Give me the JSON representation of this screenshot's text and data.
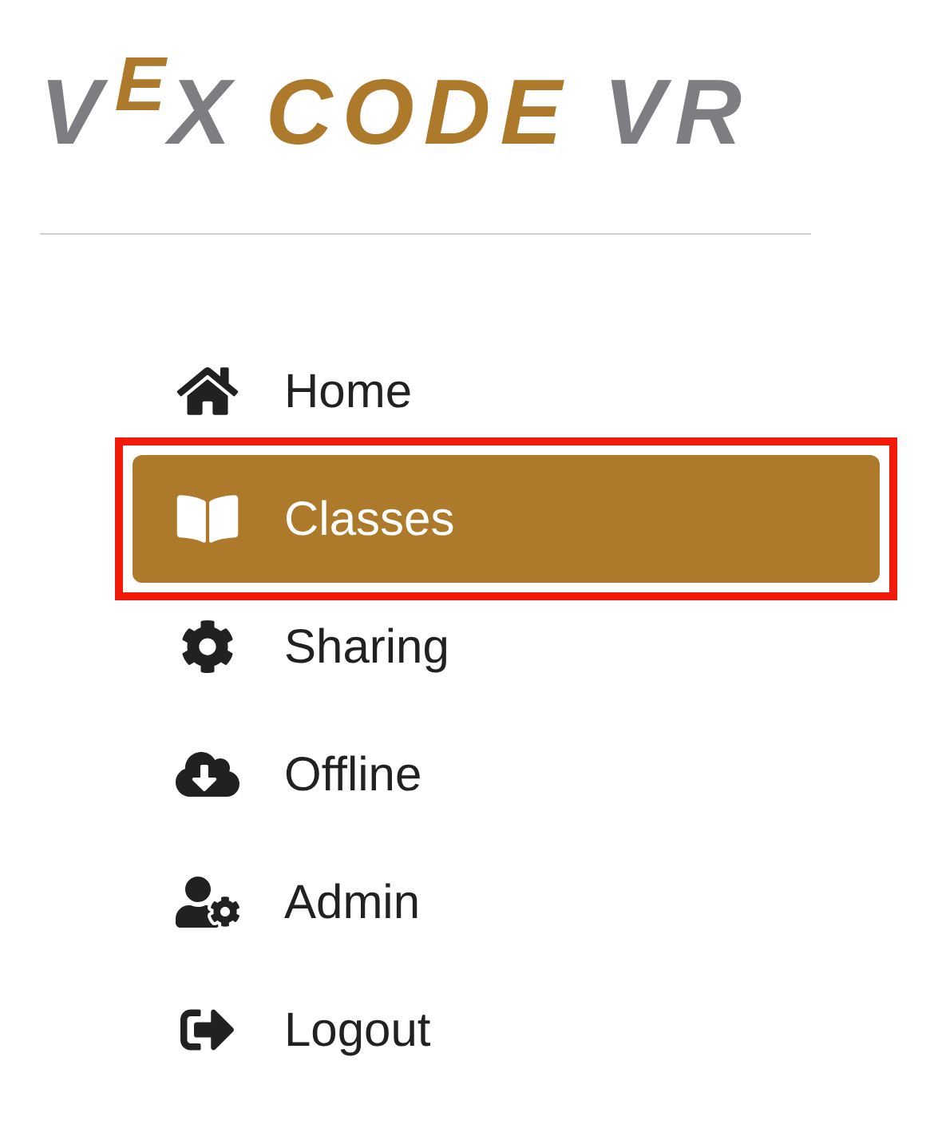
{
  "logo": {
    "brand_start": "V",
    "brand_mark": "E",
    "brand_end": "X",
    "product": "CODE",
    "suffix": "VR"
  },
  "menu": [
    {
      "label": "Home",
      "kind": "home",
      "selected": false,
      "highlighted": false
    },
    {
      "label": "Classes",
      "kind": "book",
      "selected": true,
      "highlighted": true
    },
    {
      "label": "Sharing",
      "kind": "gear",
      "selected": false,
      "highlighted": false
    },
    {
      "label": "Offline",
      "kind": "cloud",
      "selected": false,
      "highlighted": false
    },
    {
      "label": "Admin",
      "kind": "user-gear",
      "selected": false,
      "highlighted": false
    },
    {
      "label": "Logout",
      "kind": "logout",
      "selected": false,
      "highlighted": false
    }
  ]
}
